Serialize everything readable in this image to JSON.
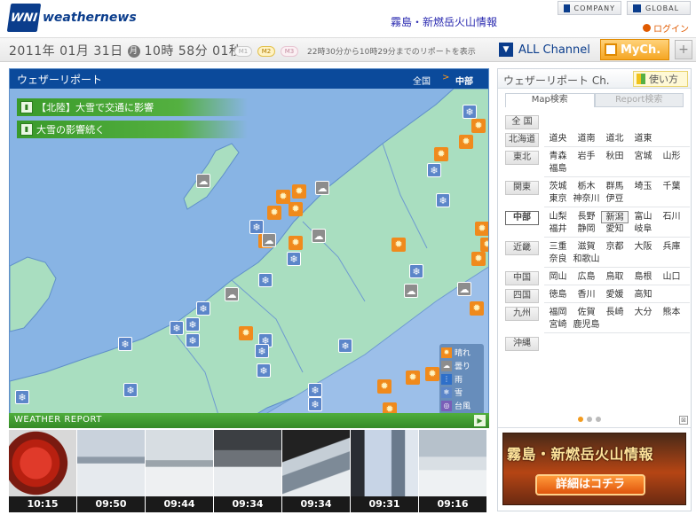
{
  "header": {
    "logo_mark": "WNI",
    "logo_text": "weathernews",
    "promo_link": "霧島・新燃岳火山情報",
    "company_btn": "COMPANY",
    "global_btn": "GLOBAL",
    "login": "ログイン"
  },
  "datebar": {
    "date_main": "2011年 01月 31日",
    "weekday": "月",
    "time": "10時 58分 01秒",
    "m1": "M1",
    "m2": "M2",
    "m3": "M3",
    "note": "22時30分から10時29分までのリポートを表示",
    "all_channel": "ALL Channel",
    "mych": "MyCh.",
    "plus": "+"
  },
  "map": {
    "title": "ウェザーリポート",
    "crumb_nation": "全国",
    "crumb_arrow": ">",
    "crumb_region": "中部",
    "headlines": [
      "【北陸】大雪で交通に影響",
      "大雪の影響続く"
    ],
    "legend": [
      "晴れ",
      "曇り",
      "雨",
      "雪",
      "台風"
    ],
    "icons": {
      "sun": "sun-icon",
      "cloud": "cloud-icon",
      "snow": "snow-icon"
    }
  },
  "report": {
    "label": "WEATHER REPORT",
    "times": [
      "10:15",
      "09:50",
      "09:44",
      "09:34",
      "09:34",
      "09:31",
      "09:16"
    ]
  },
  "right_panel": {
    "title": "ウェザーリポート Ch.",
    "howto": "使い方",
    "tab_map": "Map検索",
    "tab_report": "Report検索",
    "regions": [
      {
        "name": "全 国",
        "prefs": []
      },
      {
        "name": "北海道",
        "prefs": [
          "道央",
          "道南",
          "道北",
          "道東"
        ]
      },
      {
        "name": "東北",
        "prefs": [
          "青森",
          "岩手",
          "秋田",
          "宮城",
          "山形",
          "福島"
        ]
      },
      {
        "name": "関東",
        "prefs": [
          "茨城",
          "栃木",
          "群馬",
          "埼玉",
          "千葉",
          "東京",
          "神奈川",
          "伊豆"
        ]
      },
      {
        "name": "中部",
        "prefs": [
          "山梨",
          "長野",
          "新潟",
          "富山",
          "石川",
          "福井",
          "静岡",
          "愛知",
          "岐阜"
        ]
      },
      {
        "name": "近畿",
        "prefs": [
          "三重",
          "滋賀",
          "京都",
          "大阪",
          "兵庫",
          "奈良",
          "和歌山"
        ]
      },
      {
        "name": "中国",
        "prefs": [
          "岡山",
          "広島",
          "鳥取",
          "島根",
          "山口"
        ]
      },
      {
        "name": "四国",
        "prefs": [
          "徳島",
          "香川",
          "愛媛",
          "高知"
        ]
      },
      {
        "name": "九州",
        "prefs": [
          "福岡",
          "佐賀",
          "長崎",
          "大分",
          "熊本",
          "宮崎",
          "鹿児島"
        ]
      },
      {
        "name": "沖縄",
        "prefs": []
      }
    ],
    "active_region": "中部",
    "active_pref": "新潟",
    "promo_title": "霧島・新燃岳火山情報",
    "promo_cta": "詳細はコチラ"
  },
  "colors": {
    "brand_blue": "#0b3d8c",
    "accent_orange": "#f08a1c",
    "report_green": "#3a9a2a",
    "sea": "#88b4e4",
    "land": "#a9dec0"
  }
}
